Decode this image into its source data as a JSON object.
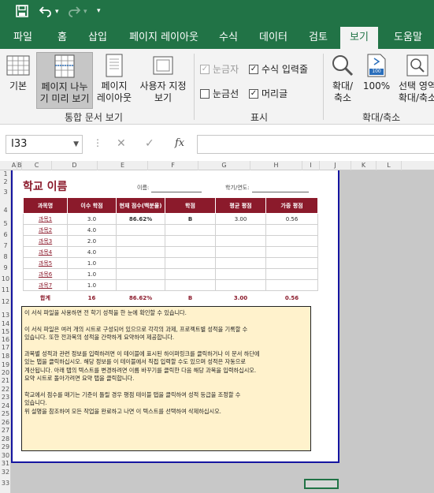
{
  "quick_access": {
    "save_icon": "save-icon",
    "undo_icon": "undo-icon",
    "redo_icon": "redo-icon",
    "customize_icon": "customize-icon"
  },
  "ribbon_tabs": [
    "파일",
    "홈",
    "삽입",
    "페이지 레이아웃",
    "수식",
    "데이터",
    "검토",
    "보기",
    "도움말"
  ],
  "active_tab": "보기",
  "ribbon": {
    "views": {
      "normal": "기본",
      "page_break_l1": "페이지 나누",
      "page_break_l2": "기 미리 보기",
      "page_layout_l1": "페이지",
      "page_layout_l2": "레이아웃",
      "custom_l1": "사용자 지정",
      "custom_l2": "보기",
      "group": "통합 문서 보기"
    },
    "show": {
      "ruler": "눈금자",
      "formula_bar": "수식 입력줄",
      "gridlines": "눈금선",
      "headings": "머리글",
      "group": "표시"
    },
    "zoom": {
      "zoom_l1": "확대/",
      "zoom_l2": "축소",
      "hundred": "100%",
      "hundred_icon_text": "100",
      "selection_l1": "선택 영역",
      "selection_l2": "확대/축소",
      "group": "확대/축소"
    }
  },
  "formula_bar": {
    "name_box": "I33",
    "fx": "fx",
    "value": ""
  },
  "columns": [
    "A",
    "B",
    "C",
    "D",
    "E",
    "F",
    "G",
    "H",
    "I",
    "J",
    "K",
    "L"
  ],
  "rows": [
    "1",
    "2",
    "3",
    "4",
    "5",
    "6",
    "7",
    "8",
    "9",
    "10",
    "11",
    "12",
    "13",
    "14",
    "15",
    "16",
    "17",
    "18",
    "19",
    "20",
    "21",
    "22",
    "23",
    "24",
    "25",
    "26",
    "27",
    "28",
    "29",
    "30",
    "31",
    "32",
    "33"
  ],
  "sheet": {
    "title": "학교 이름",
    "name_label": "이름:",
    "year_label": "학기/연도:",
    "headers": [
      "과목명",
      "이수 학점",
      "현재 점수(백분율)",
      "학점",
      "평균 평점",
      "가중 평점"
    ],
    "rows": [
      [
        "과목1",
        "3.0",
        "86.62%",
        "B",
        "3.00",
        "0.56"
      ],
      [
        "과목2",
        "4.0",
        "",
        "",
        "",
        ""
      ],
      [
        "과목3",
        "2.0",
        "",
        "",
        "",
        ""
      ],
      [
        "과목4",
        "4.0",
        "",
        "",
        "",
        ""
      ],
      [
        "과목5",
        "1.0",
        "",
        "",
        "",
        ""
      ],
      [
        "과목6",
        "1.0",
        "",
        "",
        "",
        ""
      ],
      [
        "과목7",
        "1.0",
        "",
        "",
        "",
        ""
      ]
    ],
    "total": [
      "합계",
      "16",
      "86.62%",
      "B",
      "3.00",
      "0.56"
    ]
  },
  "note_lines": [
    "이 서식 파일을 사용하면 전 학기 성적을 한 눈에 확인할 수 있습니다.",
    "",
    "이 서식 파일은 여러 개의 시트로 구성되어 있으므로 각각의 과제, 프로젝트별 성적을 기록할 수",
    "있습니다.  또한 전과목의 성적을 간략하게 요약하여 제공합니다.",
    "",
    "과목별 성적과 관련 정보를 입력하려면 이 테이블에 표시된 하이퍼링크를 클릭하거나 이 문서 하단에",
    "있는 탭을 클릭하십시오. 해당 정보를 이 테이블에서 직접 입력할 수도 있으며 성적은 자동으로",
    "계산됩니다. 아래 탭의 텍스트를 변경하려면 이름 바꾸기를 클릭한 다음 해당 과목을 입력하십시오.",
    "요약 시트로 돌아가려면 요약 탭을 클릭합니다.",
    "",
    "학교에서 점수를 매기는 기준이 틀릴 경우 평점 테이블 탭을 클릭하여 성적 등급을 조정할 수",
    "있습니다.",
    "위 설명을 참조하여 모든 작업을 완료하고 나면 이 텍스트를 선택하여 삭제하십시오."
  ],
  "colors": {
    "excel_green": "#217346",
    "accent": "#8b1a2b",
    "note_bg": "#fff2cc",
    "page_border": "#1515a0"
  }
}
